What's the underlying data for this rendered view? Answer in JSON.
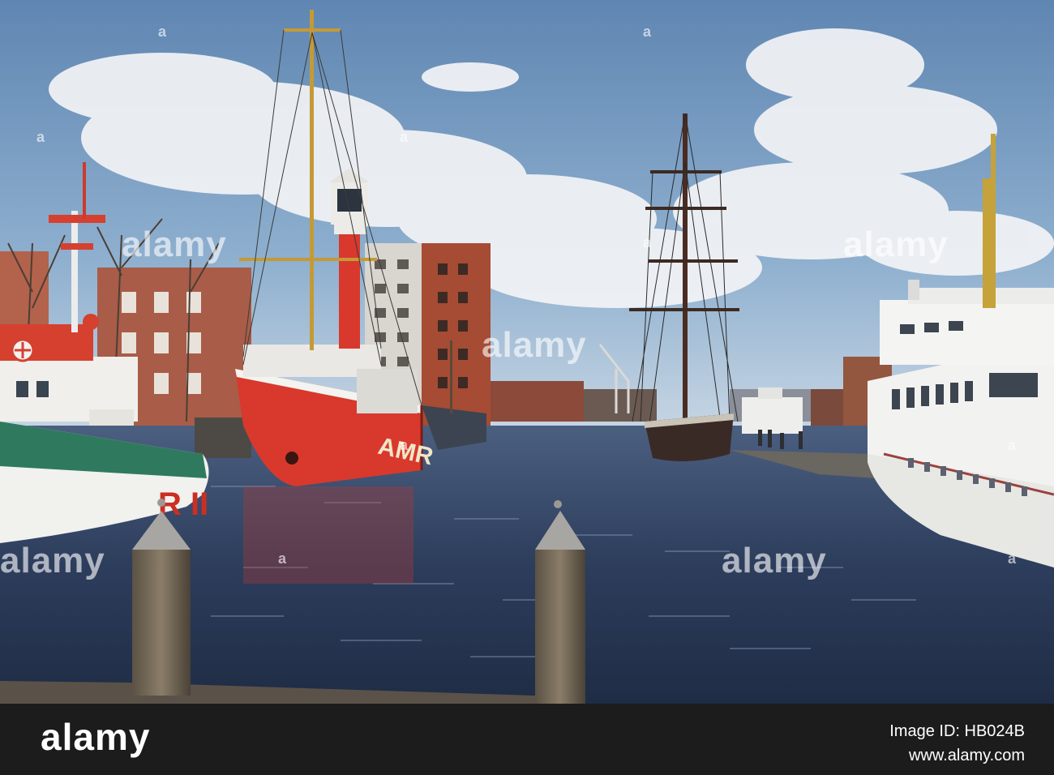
{
  "photo": {
    "description_alt": "Harbour with moored ships",
    "hull_lettering": "AMR",
    "rescue_letters": "R II"
  },
  "watermarks": {
    "main": "alamy",
    "small": "a"
  },
  "footer": {
    "logo": "alamy",
    "image_id": "Image ID: HB024B",
    "url": "www.alamy.com"
  },
  "colors": {
    "sky": "#6f93b8",
    "water": "#2b3a55",
    "lightship_red": "#d8392c",
    "footer_bg": "#1c1c1c"
  }
}
